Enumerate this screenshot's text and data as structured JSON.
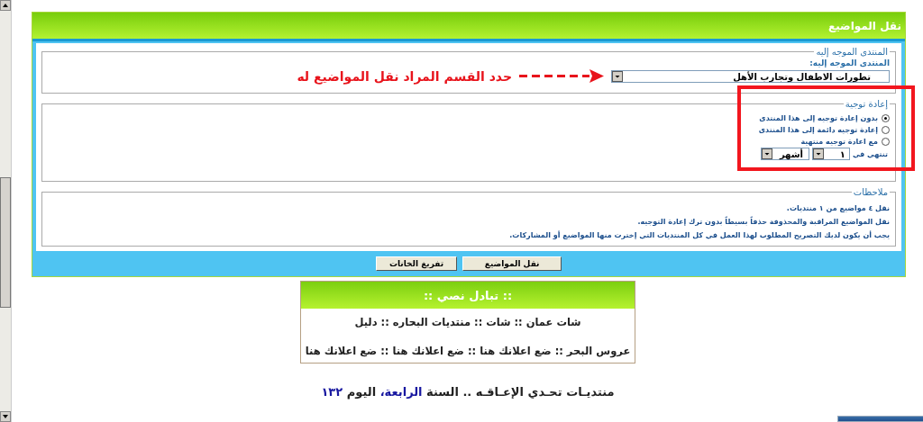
{
  "panel": {
    "title": "نقل المواضيع"
  },
  "destination": {
    "legend": "المنتدى الموجه إليه",
    "label": "المنتدى الموجه إليه:",
    "value": "تطورات الاطفال وتجارب الأهل"
  },
  "annotation": {
    "text": "حدد القسم المراد نقل المواضيع له"
  },
  "redirect": {
    "legend": "إعادة توجية",
    "options": [
      {
        "label": "بدون إعادة توجيه إلى هذا المنتدى",
        "selected": true
      },
      {
        "label": "إعادة توجيه دائمة إلى هذا المنتدى",
        "selected": false
      },
      {
        "label": "مع اعادة توجيه منتهية",
        "selected": false
      }
    ],
    "expiry": {
      "label": "تنتهي في",
      "amount": "١",
      "unit": "أشهر"
    }
  },
  "notes": {
    "legend": "ملاحظات",
    "lines": [
      "نقل ٤ مواضيع من ١ منتديات.",
      "نقل المواضيع المراقبة والمحذوفة حذفاً بسيطاً بدون ترك إعادة التوجيه.",
      "يجب أن يكون لديك التصريح المطلوب لهذا العمل في كل المنتديات التي إخترت منها المواضيع أو المشاركات."
    ]
  },
  "buttons": [
    {
      "kind": "submit",
      "label": "نقل المواضيع"
    },
    {
      "kind": "reset",
      "label": "تفريغ الخانات"
    }
  ],
  "exchange": {
    "title": ":: تبادل نصي ::",
    "lines": [
      "شات عمان :: شات :: منتديات البحاره :: دليل",
      "عروس البحر :: ضع اعلانك هنا :: ضع اعلانك هنا :: ضع اعلانك هنا"
    ]
  },
  "footer": [
    {
      "text": "منتديـات تحـدي الإعـاقـه .. السنة",
      "highlight": false
    },
    {
      "text": "الرابعة،",
      "highlight": true
    },
    {
      "text": "اليوم",
      "highlight": false
    },
    {
      "text": "١٣٢",
      "highlight": true
    }
  ]
}
